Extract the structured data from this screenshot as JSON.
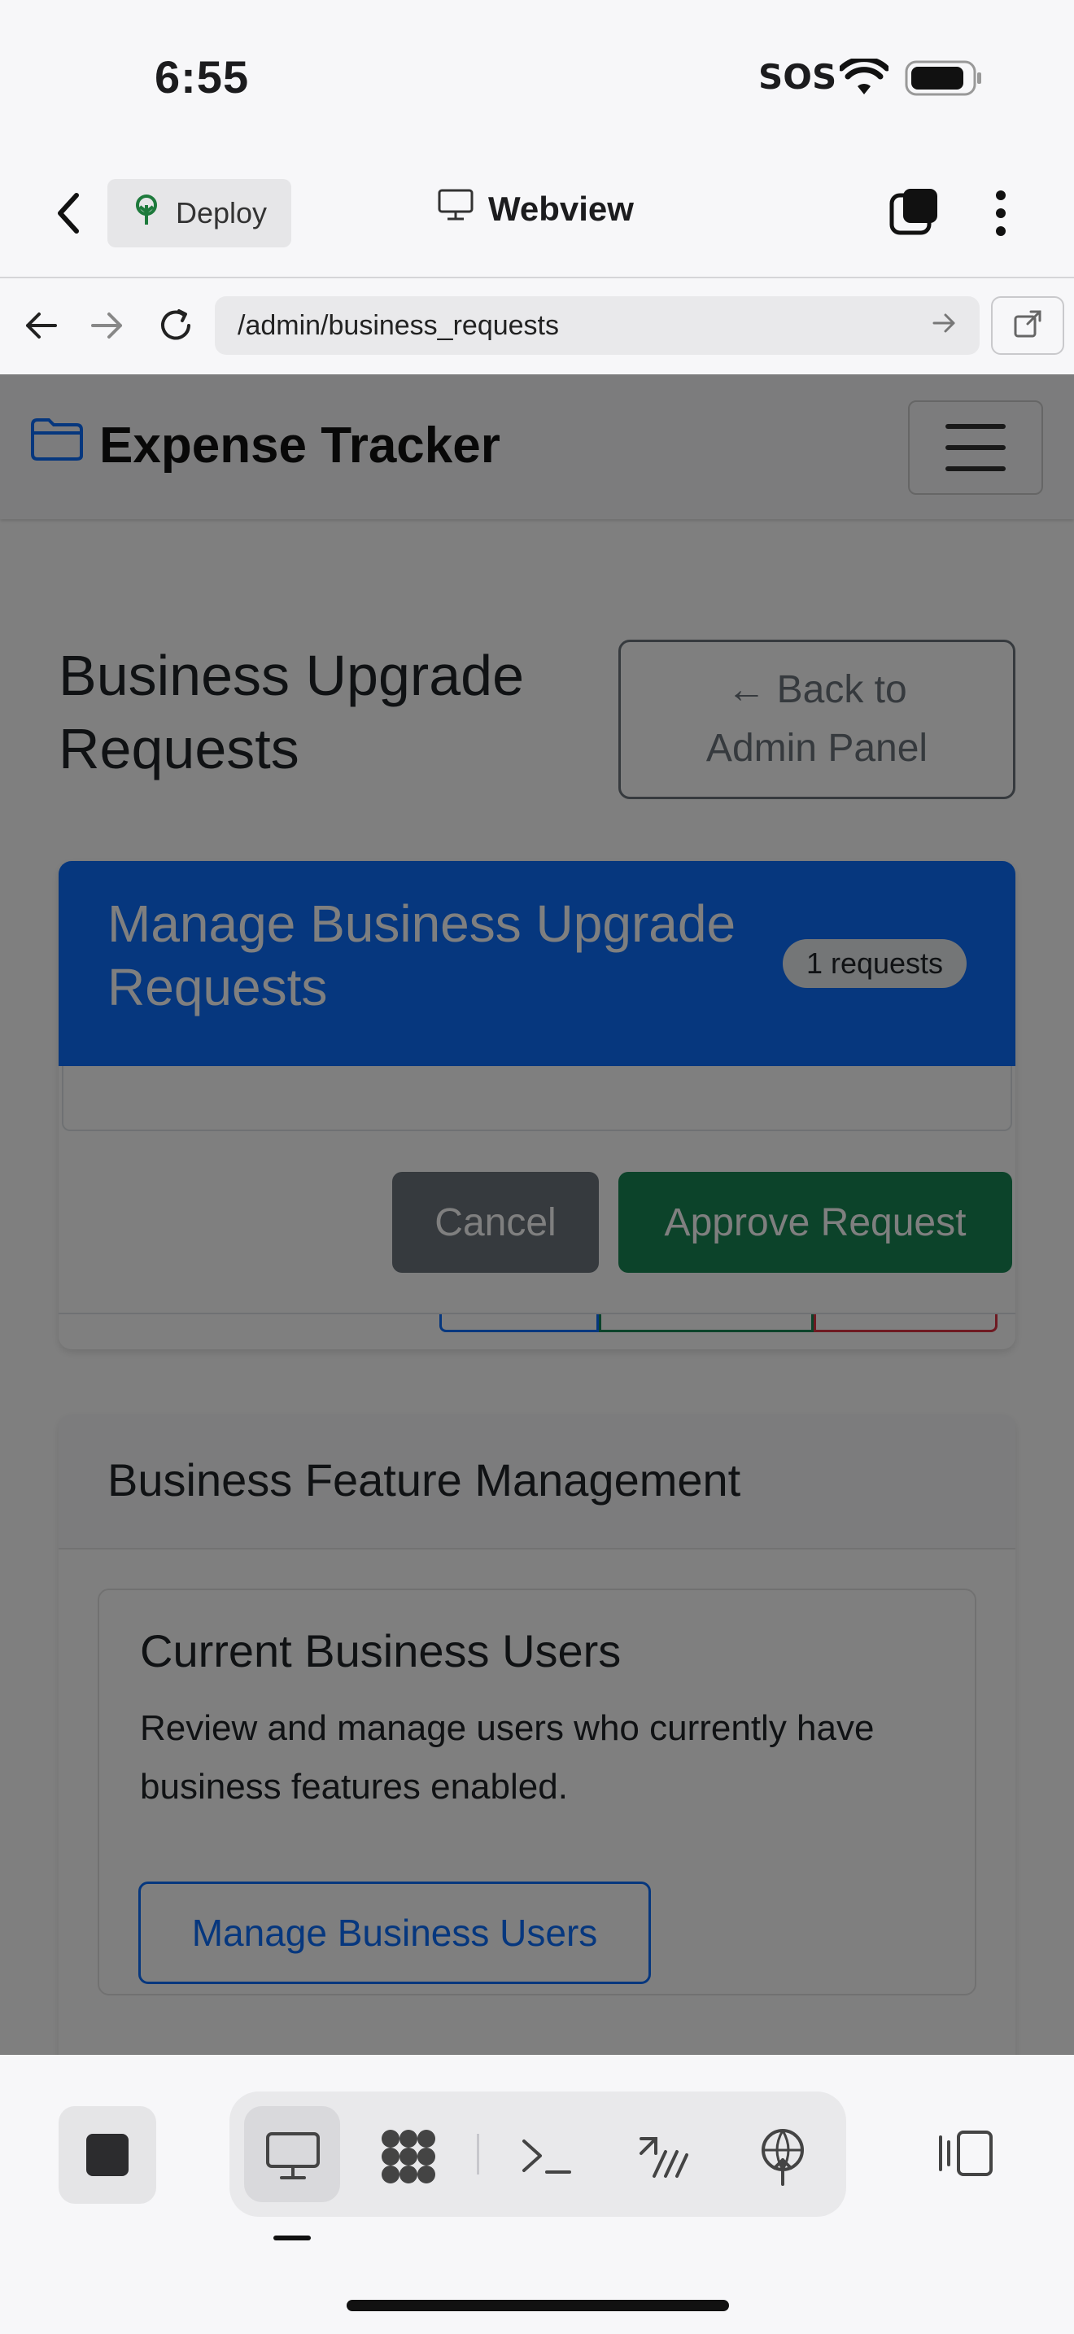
{
  "status_bar": {
    "time": "6:55",
    "sos": "SOS"
  },
  "toolbar": {
    "deploy_label": "Deploy",
    "webview_label": "Webview"
  },
  "url_bar": {
    "url": "/admin/business_requests"
  },
  "navbar": {
    "brand": "Expense Tracker"
  },
  "page": {
    "title": "Business Upgrade Requests",
    "back_label_line1": "← Back to",
    "back_label_line2": "Admin Panel"
  },
  "requests_card": {
    "header_title": "Manage Business Upgrade Requests",
    "badge": "1 requests",
    "cancel_label": "Cancel",
    "approve_label": "Approve Request"
  },
  "features_card": {
    "header_title": "Business Feature Management",
    "section_title": "Current Business Users",
    "section_text": "Review and manage users who currently have business features enabled.",
    "manage_label": "Manage Business Users"
  },
  "colors": {
    "primary": "#0d6efd",
    "success": "#198754",
    "secondary": "#6c757d",
    "overlay": "rgba(0,0,0,0.5)"
  }
}
